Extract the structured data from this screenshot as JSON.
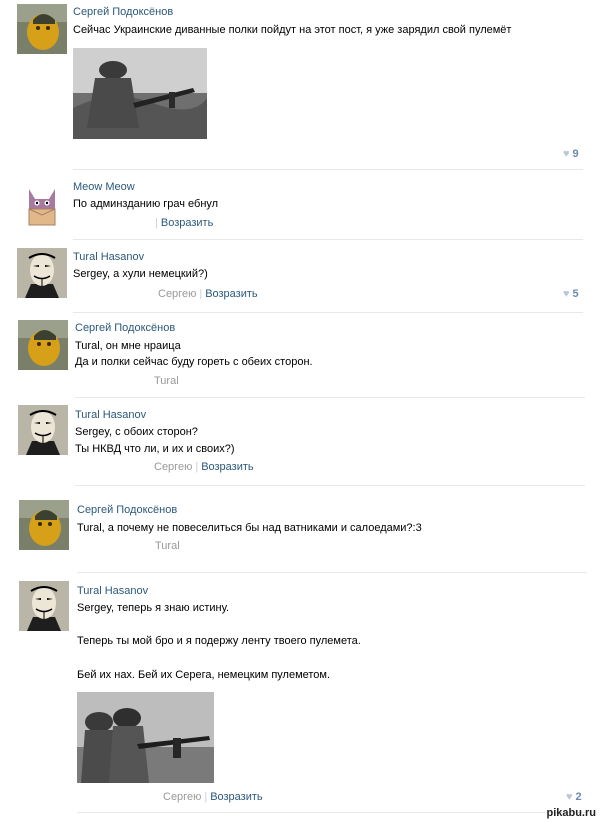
{
  "comments": [
    {
      "author": "Сергей Подоксёнов",
      "lines": [
        "Сейчас Украинские диванные полки пойдут на этот пост, я уже зарядил свой пулемёт"
      ],
      "likes": "9",
      "avatar": "sergey-avatar",
      "photo": "machine-gunner-photo"
    },
    {
      "author": "Meow Meow",
      "lines": [
        "По админзданию грач ебнул"
      ],
      "reply_label": "Возразить",
      "avatar": "cat-avatar"
    },
    {
      "author": "Tural Hasanov",
      "lines": [
        "Sergey, а хули немецкий?)"
      ],
      "addressee": "Сергею",
      "reply_label": "Возразить",
      "likes": "5",
      "avatar": "guy-fawkes-mask-avatar"
    },
    {
      "author": "Сергей Подоксёнов",
      "lines": [
        "Tural, он мне нраица",
        "Да и полки сейчас буду гореть с обеих сторон."
      ],
      "addressee": "Tural",
      "avatar": "sergey-avatar"
    },
    {
      "author": "Tural Hasanov",
      "lines": [
        "Sergey, с обоих сторон?",
        "Ты НКВД что ли, и их и своих?)"
      ],
      "addressee": "Сергею",
      "reply_label": "Возразить",
      "avatar": "guy-fawkes-mask-avatar"
    },
    {
      "author": "Сергей Подоксёнов",
      "lines": [
        "Tural, а почему не повеселиться бы над ватниками и салоедами?:3"
      ],
      "addressee": "Tural",
      "avatar": "sergey-avatar"
    },
    {
      "author": "Tural Hasanov",
      "lines": [
        "Sergey, теперь я знаю истину.",
        "Теперь ты мой бро и я подержу ленту твоего пулемета.",
        "Бей их нах. Бей их Серега, немецким пулеметом."
      ],
      "addressee": "Сергею",
      "reply_label": "Возразить",
      "likes": "2",
      "avatar": "guy-fawkes-mask-avatar",
      "photo": "helmeted-soldiers-photo"
    }
  ],
  "watermark": "pikabu.ru"
}
